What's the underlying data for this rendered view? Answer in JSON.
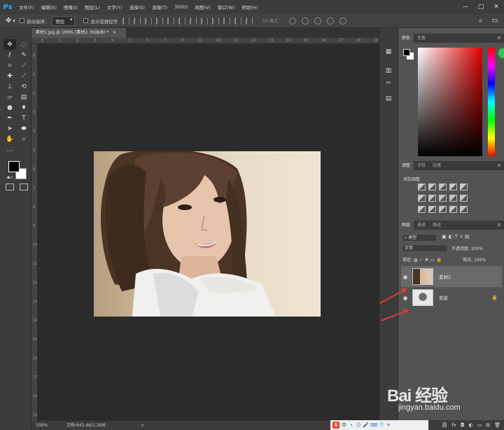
{
  "app": {
    "logo": "Ps"
  },
  "menu": [
    "文件(F)",
    "编辑(E)",
    "图像(I)",
    "图层(L)",
    "文字(Y)",
    "选择(S)",
    "滤镜(T)",
    "3D(D)",
    "视图(V)",
    "窗口(W)",
    "帮助(H)"
  ],
  "window_controls": {
    "minimize": "—",
    "maximize": "□",
    "close": "✕"
  },
  "options_bar": {
    "auto_select_label": "自动选择：",
    "auto_select_value": "图层",
    "show_transform_label": "显示变换控件",
    "mode_3d_label": "3D 模式："
  },
  "document": {
    "tab_title": "素材1.jpg @ 100% (素材2, RGB/8) *",
    "tab_close": "×",
    "zoom": "100%",
    "doc_info": "文档:643.4K/1.26M",
    "status_arrow": ">"
  },
  "rulers": {
    "h_ticks": [
      "0",
      "1",
      "2",
      "3",
      "4",
      "5",
      "6",
      "7",
      "8",
      "9",
      "10",
      "11",
      "12",
      "13",
      "14",
      "15",
      "16",
      "17",
      "18",
      "19"
    ],
    "v_ticks": [
      "0",
      "1",
      "2",
      "3",
      "4",
      "5",
      "6",
      "7",
      "8",
      "9",
      "10",
      "11",
      "12",
      "13",
      "14",
      "15",
      "16",
      "17",
      "18",
      "19"
    ]
  },
  "panels": {
    "color_tabs": [
      "颜色",
      "色板"
    ],
    "adjust_tabs": [
      "调整",
      "字符",
      "段落"
    ],
    "adjust_title": "添加调整",
    "layers_tabs": [
      "图层",
      "通道",
      "路径"
    ],
    "filter_kind": "类型",
    "blend_mode": "正常",
    "opacity_label": "不透明度:",
    "opacity_value": "100%",
    "lock_label": "锁定:",
    "fill_label": "填充:",
    "fill_value": "100%",
    "menu_glyph": "≡"
  },
  "layers": [
    {
      "name": "素材2",
      "selected": true,
      "visible": true,
      "locked": false
    },
    {
      "name": "背景",
      "selected": false,
      "visible": true,
      "locked": true
    }
  ],
  "watermark": {
    "main": "Bai  经验",
    "sub": "jingyan.baidu.com"
  },
  "ime": {
    "logo": "S",
    "lang": "中",
    "icons": "•, ☺ 🎤 ⌨ 👕 ✈"
  },
  "colors": {
    "app_bg": "#535353",
    "canvas_bg": "#2b2b2b",
    "panel_dark": "#3c3c3c",
    "accent_blue": "#31a8ff",
    "arrow_red": "#e23a32"
  }
}
